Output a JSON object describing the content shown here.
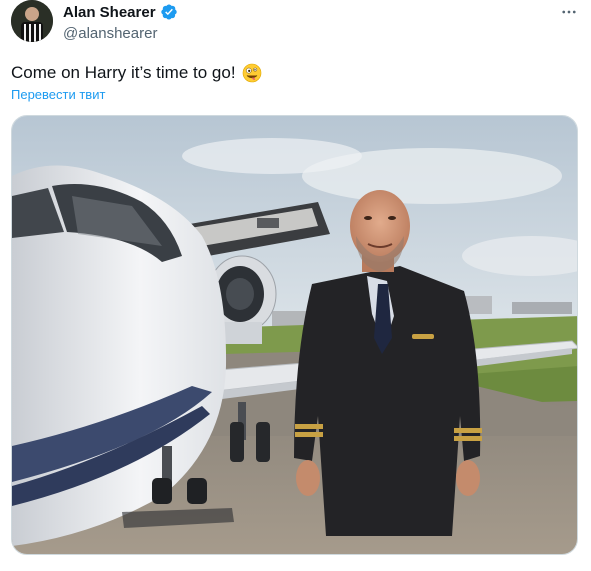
{
  "tweet": {
    "author": {
      "display_name": "Alan Shearer",
      "handle": "@alanshearer",
      "verified": true,
      "verified_color": "#1d9bf0"
    },
    "text": "Come on Harry it’s time to go!",
    "emoji_icon": "zany-face-icon",
    "translate_label": "Перевести твит",
    "more_icon": "more-dots-icon",
    "link_color": "#1d9bf0"
  }
}
